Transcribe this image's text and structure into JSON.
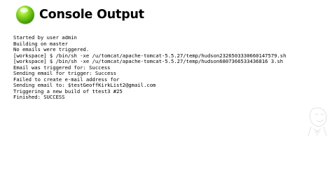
{
  "header": {
    "title": "Console Output",
    "status_color": "#5fb80c",
    "status_icon": "green-ball-icon"
  },
  "console": {
    "lines": [
      "Started by user admin",
      "Building on master",
      "No emails were triggered.",
      "[workspace] $ /bin/sh -xe /u/tomcat/apache-tomcat-5.5.27/temp/hudson2326503330660147579.sh",
      "[workspace] $ /bin/sh -xe /u/tomcat/apache-tomcat-5.5.27/temp/hudson6807366533436816 3.sh",
      "Email was triggered for: Success",
      "Sending email for trigger: Success",
      "Failed to create e-mail address for",
      "Sending email to: $testGeoffKirkList2@gmail.com",
      "Triggering a new build of ttest3 #25",
      "Finished: SUCCESS"
    ]
  },
  "background": {
    "watermark_icon": "jenkins-butler-watermark"
  }
}
